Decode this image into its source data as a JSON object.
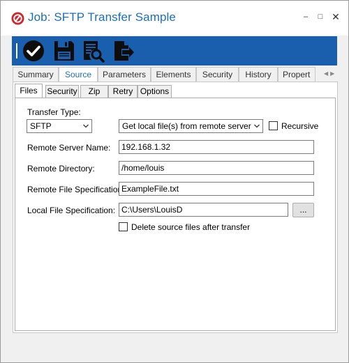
{
  "window": {
    "title": "Job: SFTP Transfer Sample",
    "controls": {
      "minimize": "–",
      "maximize": "□",
      "close": "✕"
    }
  },
  "toolbar": {
    "background_color": "#1a5fae",
    "buttons": [
      {
        "icon": "checkmark-circle-icon"
      },
      {
        "icon": "floppy-disk-icon"
      },
      {
        "icon": "document-search-icon"
      },
      {
        "icon": "document-export-icon"
      }
    ]
  },
  "tabs": {
    "active": "Source",
    "items": [
      "Summary",
      "Source",
      "Parameters",
      "Elements",
      "Security",
      "History",
      "Propert"
    ]
  },
  "subtabs": {
    "active": "Files",
    "items": [
      "Files",
      "Security",
      "Zip",
      "Retry",
      "Options"
    ]
  },
  "form": {
    "transfer_type_label": "Transfer Type:",
    "transfer_type_value": "SFTP",
    "direction_value": "Get local file(s) from remote server",
    "recursive_label": "Recursive",
    "recursive_checked": false,
    "remote_server_name_label": "Remote Server Name:",
    "remote_server_name_value": "192.168.1.32",
    "remote_directory_label": "Remote Directory:",
    "remote_directory_value": "/home/louis",
    "remote_file_spec_label": "Remote File Specification:",
    "remote_file_spec_value": "ExampleFile.txt",
    "local_file_spec_label": "Local File Specification:",
    "local_file_spec_value": "C:\\Users\\LouisD",
    "browse_label": "...",
    "delete_source_label": "Delete source files after transfer",
    "delete_source_checked": false
  },
  "colors": {
    "title_text": "#1c6fb7",
    "active_tab_text": "#1c6fb7",
    "toolbar": "#1a5fae"
  }
}
